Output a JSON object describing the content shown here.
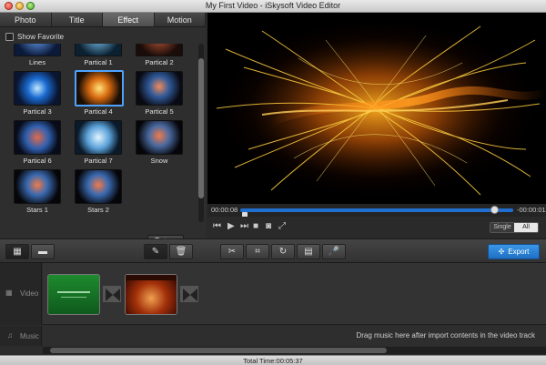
{
  "window": {
    "title": "My First Video - iSkysoft Video Editor"
  },
  "tabs": [
    {
      "label": "Photo"
    },
    {
      "label": "Title"
    },
    {
      "label": "Effect"
    },
    {
      "label": "Motion"
    }
  ],
  "active_tab": "Effect",
  "show_favorite": {
    "label": "Show Favorite",
    "checked": false
  },
  "effects": [
    {
      "label": "Lines"
    },
    {
      "label": "Partical 1"
    },
    {
      "label": "Partical 2"
    },
    {
      "label": "Partical 3"
    },
    {
      "label": "Partical 4"
    },
    {
      "label": "Partical 5"
    },
    {
      "label": "Partical 6"
    },
    {
      "label": "Partical 7"
    },
    {
      "label": "Snow"
    },
    {
      "label": "Stars 1"
    },
    {
      "label": "Stars 2"
    }
  ],
  "selected_effect": "Partical 4",
  "return_button": "Return",
  "player": {
    "time_current": "00:00:08",
    "time_remaining": "-00:00:01",
    "progress": 0.93,
    "mode_single": "Single",
    "mode_all": "All"
  },
  "toolbar": {
    "export_label": "Export"
  },
  "timeline": {
    "video_label": "Video",
    "music_label": "Music",
    "music_hint": "Drag music here after import contents in the video track"
  },
  "status": {
    "total_time": "Total Time:00:05:37"
  }
}
